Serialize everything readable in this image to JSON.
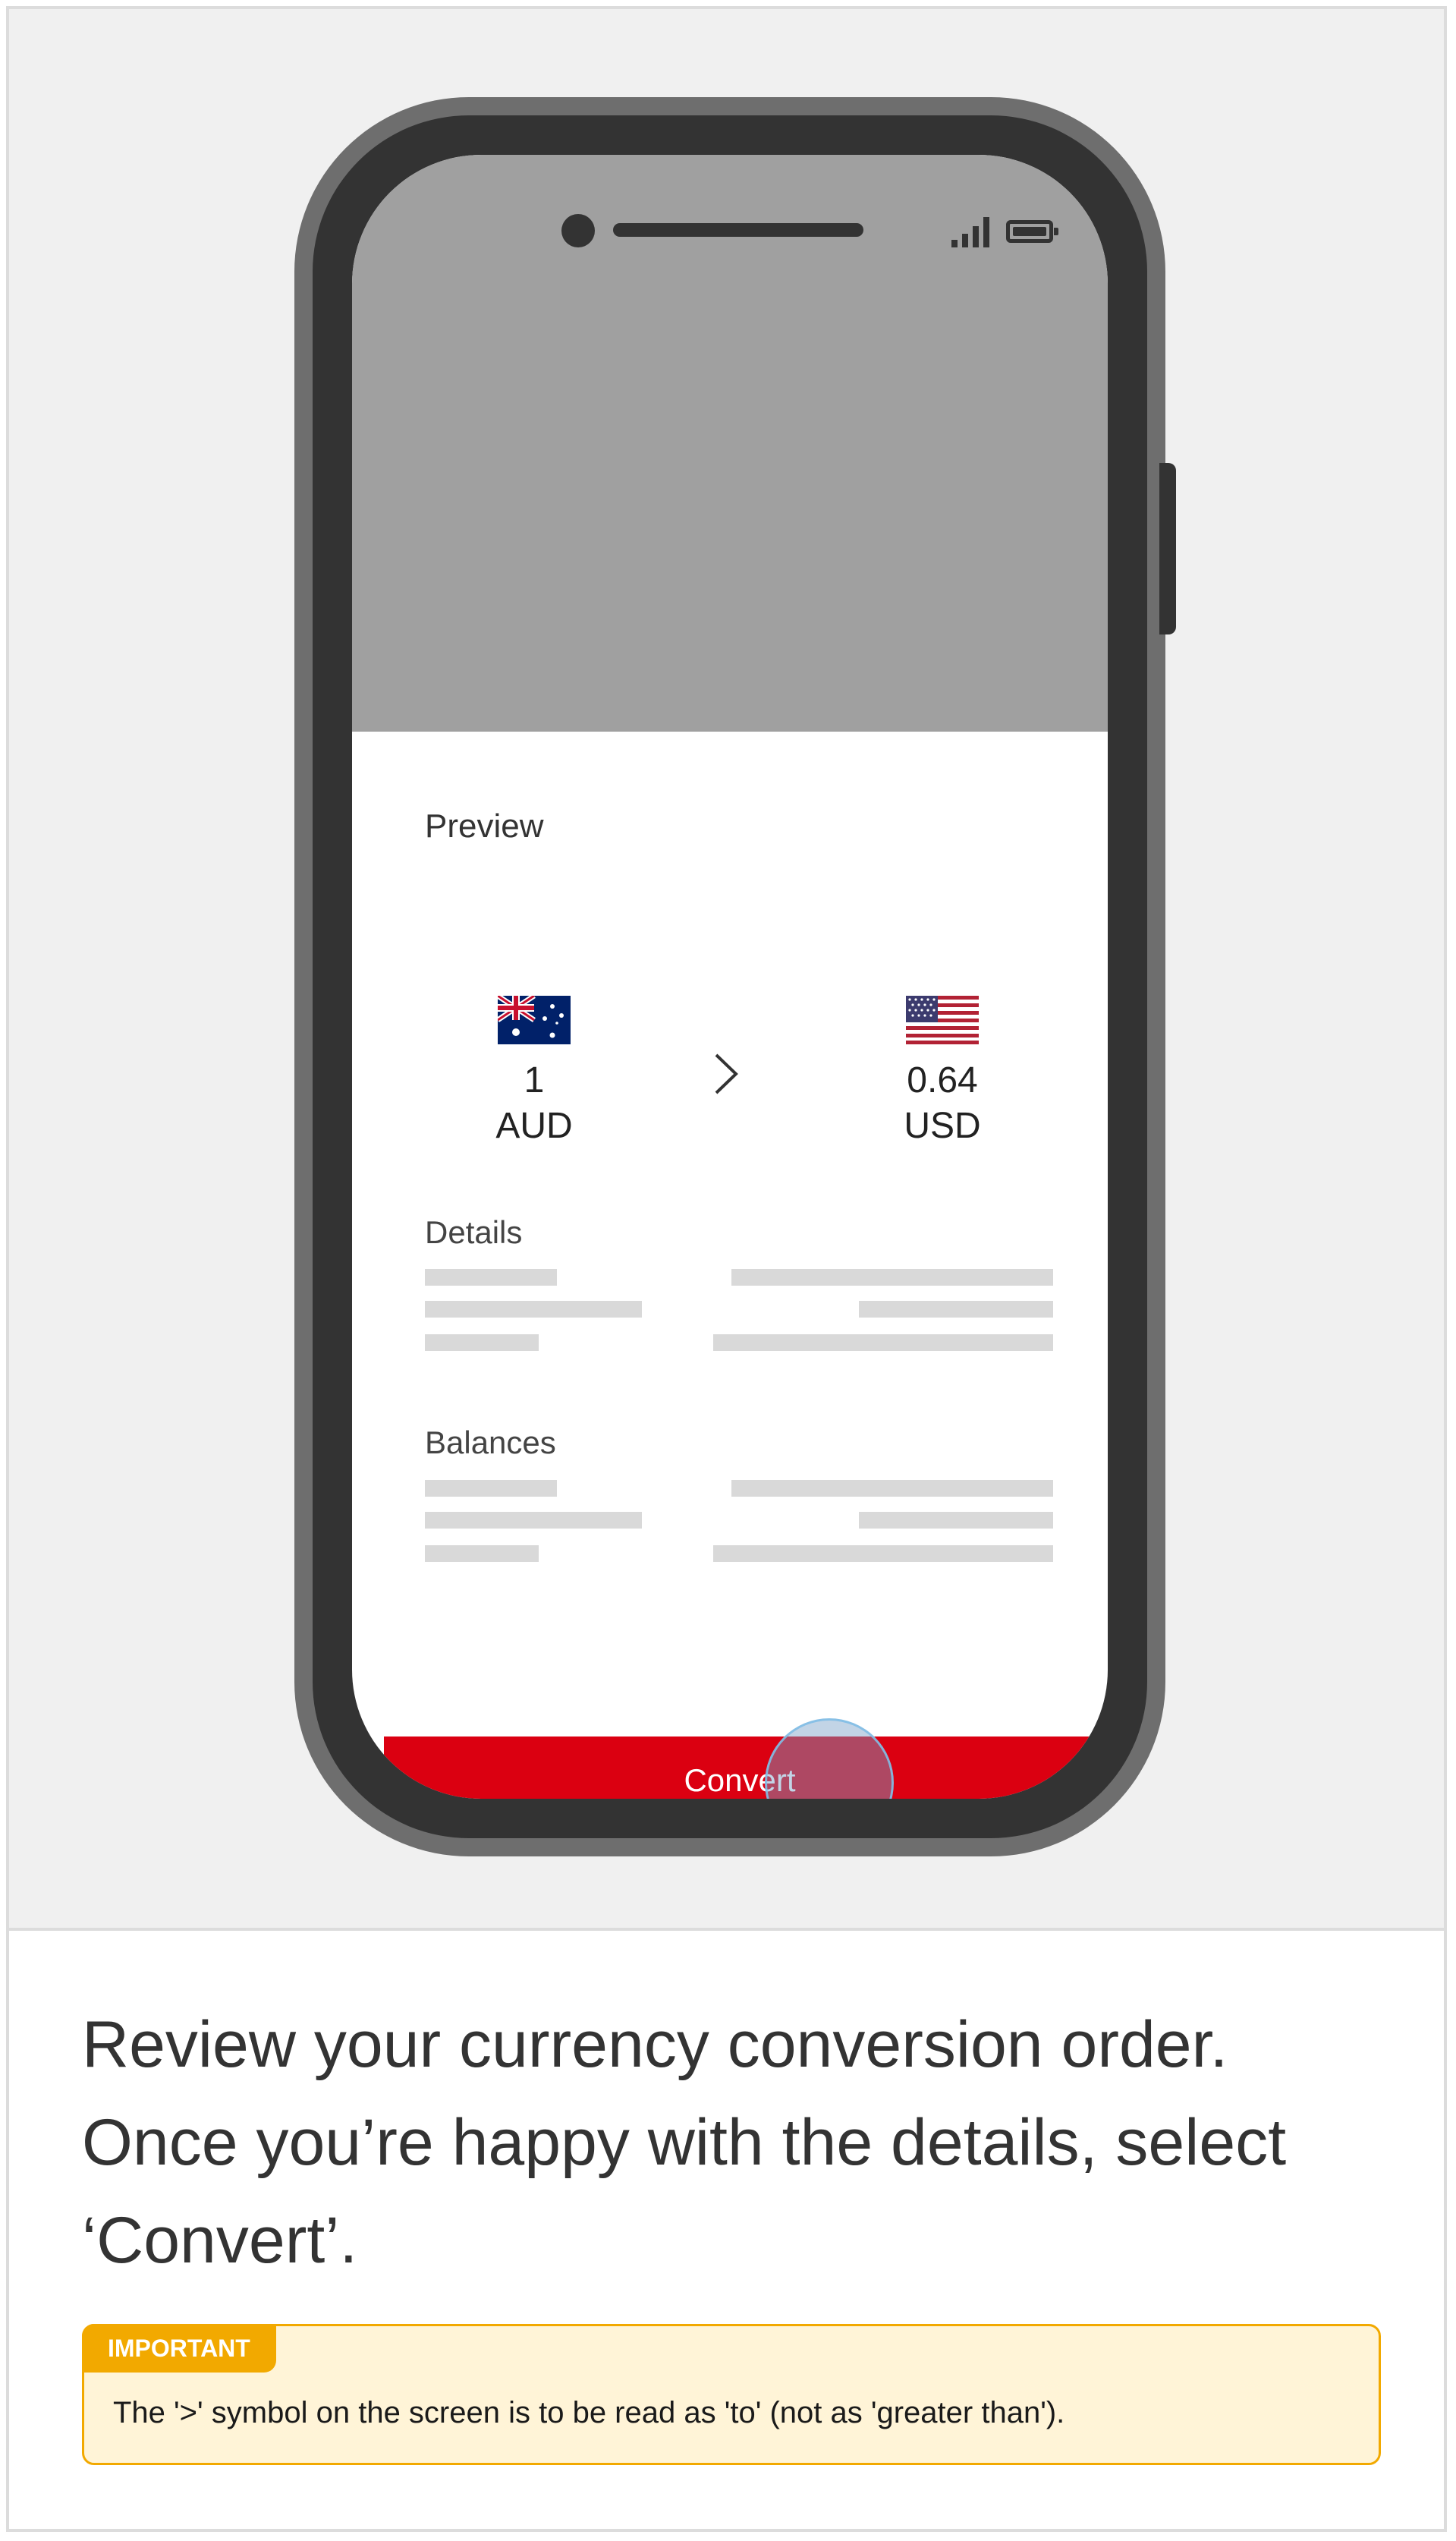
{
  "screen": {
    "preview_title": "Preview",
    "from": {
      "amount": "1",
      "currency": "AUD",
      "flag_icon": "australia-flag-icon"
    },
    "separator": ">",
    "to": {
      "amount": "0.64",
      "currency": "USD",
      "flag_icon": "usa-flag-icon"
    },
    "details_label": "Details",
    "balances_label": "Balances",
    "convert_label": "Convert"
  },
  "caption": "Review your currency conversion order. Once you’re happy with the details, select ‘Convert’.",
  "important": {
    "tag": "IMPORTANT",
    "text": "The '>' symbol on the screen is to be read as 'to' (not as 'greater than')."
  },
  "colors": {
    "brand_red": "#db0011",
    "important_accent": "#f2a900",
    "important_background": "#fff4d7"
  }
}
